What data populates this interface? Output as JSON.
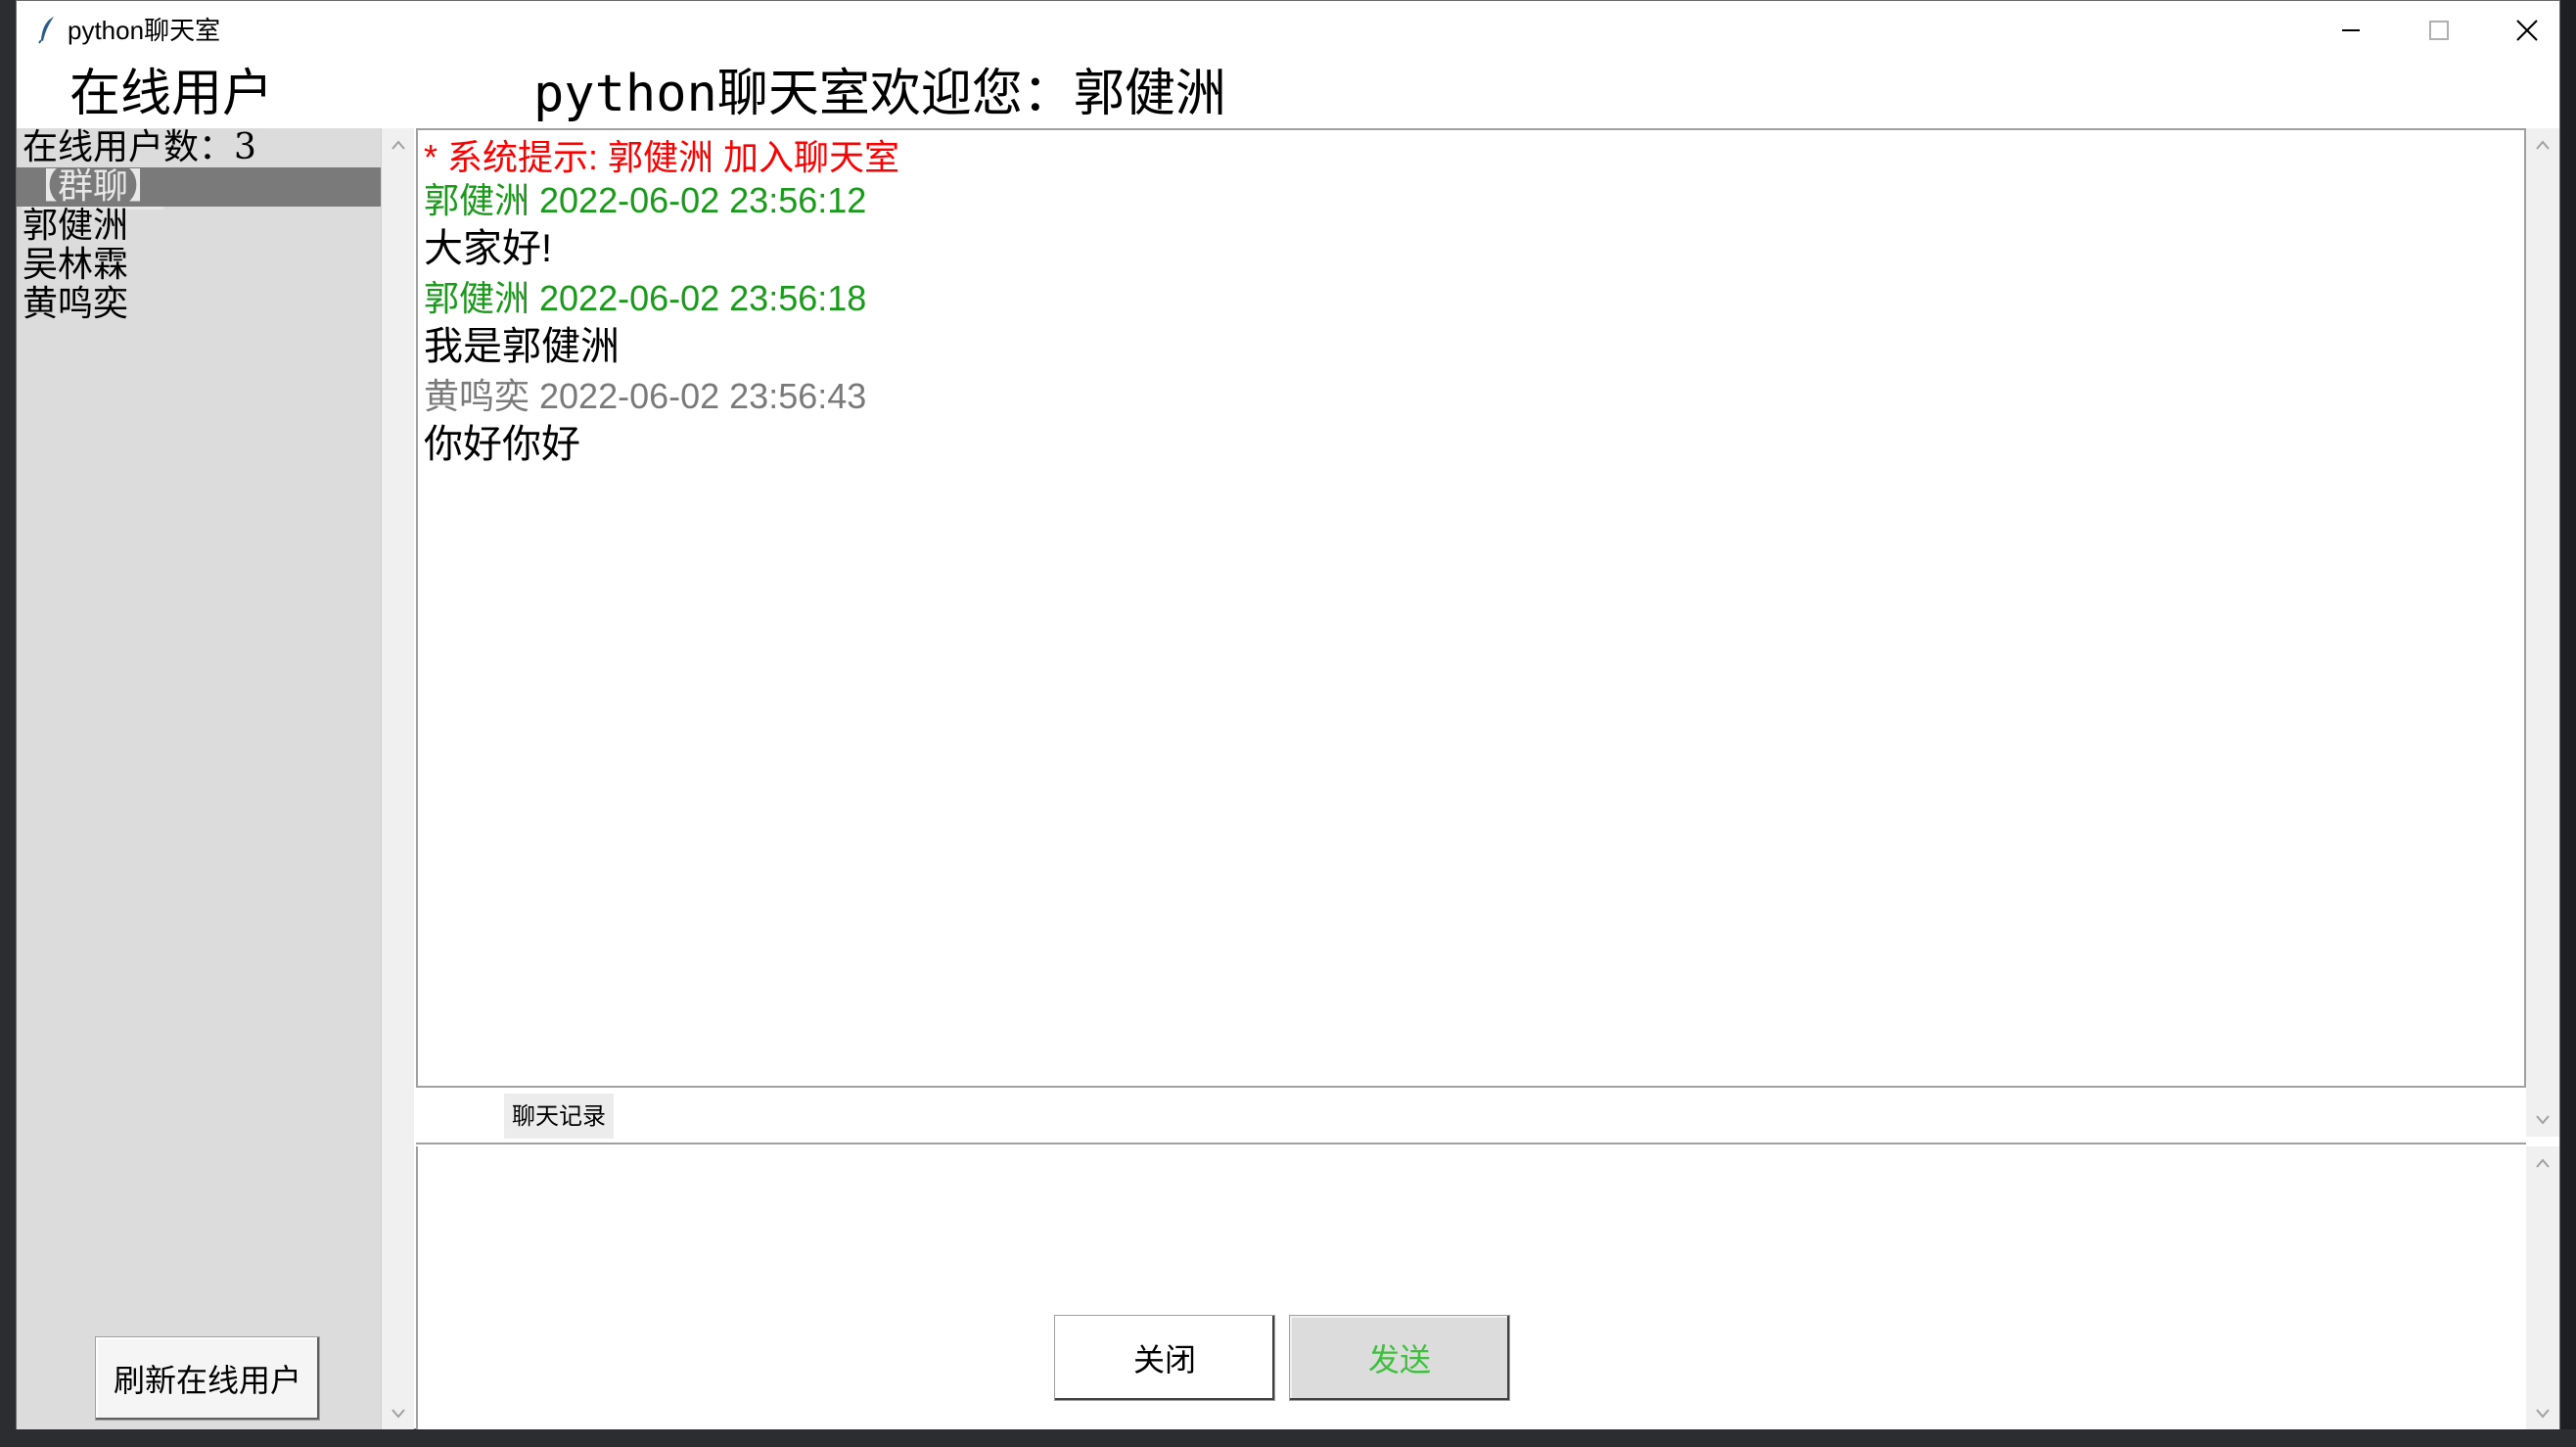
{
  "window": {
    "title": "python聊天室"
  },
  "left": {
    "title": "在线用户",
    "user_count": "在线用户数：3",
    "group_chat": "【群聊】",
    "users": [
      "郭健洲",
      "吴林霖",
      "黄鸣奕"
    ],
    "refresh_label": "刷新在线用户"
  },
  "header": {
    "welcome": "python聊天室欢迎您：郭健洲"
  },
  "chat": {
    "messages": [
      {
        "meta": "* 系统提示: 郭健洲 加入聊天室",
        "meta_color": "#ff0000",
        "body": ""
      },
      {
        "meta": "郭健洲 2022-06-02 23:56:12",
        "meta_color": "#1a9a1a",
        "body": "大家好!"
      },
      {
        "meta": "郭健洲 2022-06-02 23:56:18",
        "meta_color": "#1a9a1a",
        "body": "我是郭健洲"
      },
      {
        "meta": "黄鸣奕 2022-06-02 23:56:43",
        "meta_color": "#7a7a7a",
        "body": "你好你好"
      }
    ],
    "tab_label": "聊天记录"
  },
  "input": {
    "value": ""
  },
  "buttons": {
    "close_label": "关闭",
    "send_label": "发送",
    "send_color": "#3ec03e"
  },
  "colors": {
    "system": "#ff0000",
    "self": "#1a9a1a",
    "other": "#7a7a7a"
  }
}
